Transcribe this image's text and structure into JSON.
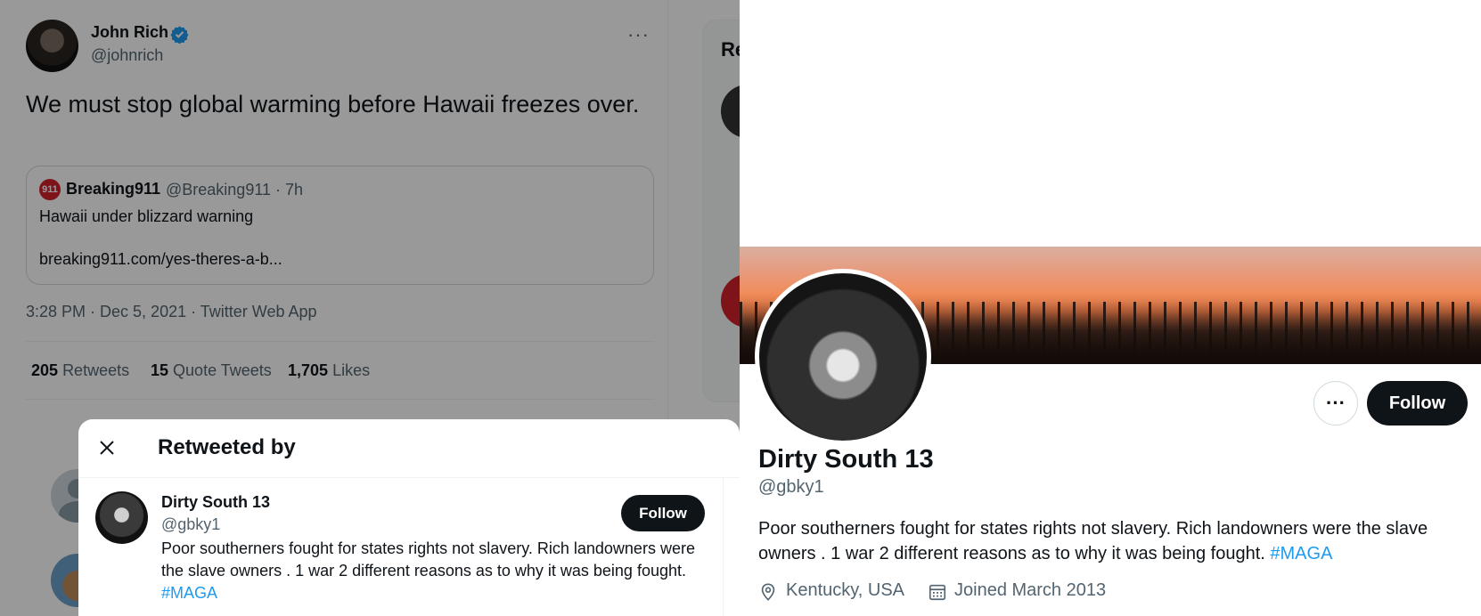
{
  "tweet": {
    "author_name": "John Rich",
    "author_handle": "@johnrich",
    "more_label": "···",
    "text": "We must stop global warming before Hawaii freezes over.",
    "quote": {
      "logo_text": "911",
      "name": "Breaking911",
      "meta": "@Breaking911 · 7h",
      "text": "Hawaii under blizzard warning",
      "link": "breaking911.com/yes-theres-a-b..."
    },
    "timestamp": "3:28 PM · Dec 5, 2021 · Twitter Web App",
    "stats": [
      {
        "count": "205",
        "label": "Retweets"
      },
      {
        "count": "15",
        "label": "Quote Tweets"
      },
      {
        "count": "1,705",
        "label": "Likes"
      }
    ]
  },
  "sidebar_peek": {
    "title": "Re"
  },
  "retweeted_by": {
    "title": "Retweeted by",
    "user": {
      "name": "Dirty South 13",
      "handle": "@gbky1",
      "follow_label": "Follow",
      "bio": "Poor southerners fought for states rights not slavery. Rich landowners were the slave owners . 1 war 2 different reasons as to why it was being fought.",
      "hashtag": "#MAGA"
    }
  },
  "profile": {
    "name": "Dirty South 13",
    "handle": "@gbky1",
    "more_label": "···",
    "follow_label": "Follow",
    "bio": "Poor southerners fought for states rights not slavery. Rich landowners were the slave owners . 1 war 2 different reasons as to why it was being fought.",
    "hashtag": "#MAGA",
    "location": "Kentucky, USA",
    "joined": "Joined March 2013"
  },
  "colors": {
    "accent": "#1d9bf0",
    "text_primary": "#0f1419",
    "text_secondary": "#536471",
    "button_dark": "#0f1419",
    "border": "#cfd9de",
    "brand_red": "#d4202c"
  },
  "icons": [
    "verified-badge-icon",
    "more-icon",
    "close-icon",
    "location-icon",
    "calendar-icon"
  ]
}
